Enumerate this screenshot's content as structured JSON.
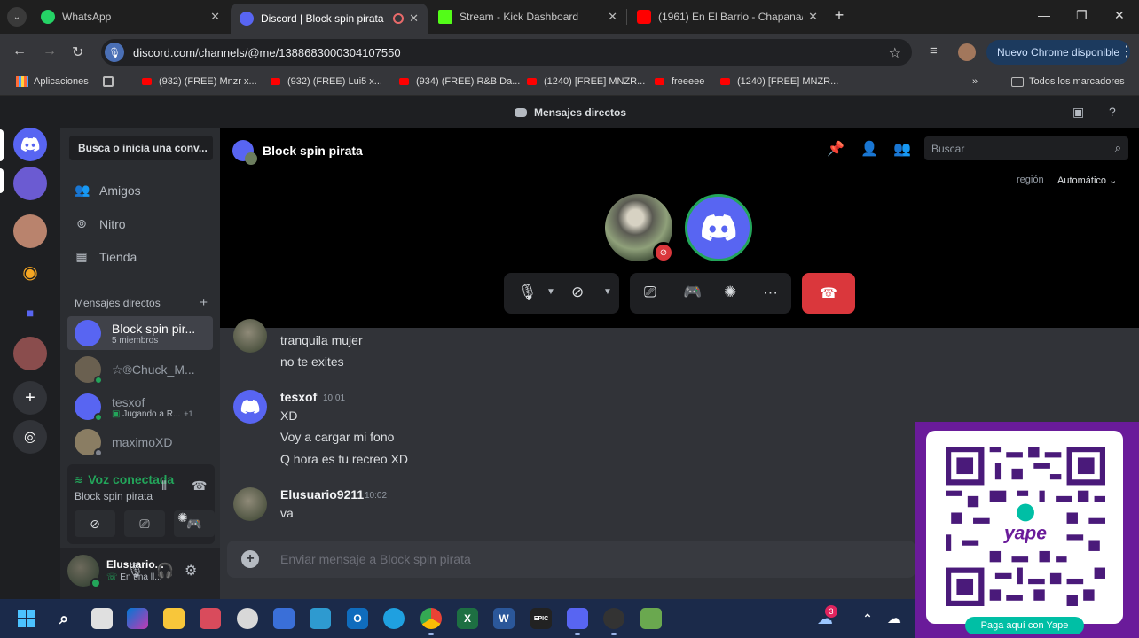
{
  "browser": {
    "tabs": [
      {
        "title": "WhatsApp",
        "color": "#25d366"
      },
      {
        "title": "Discord | Block spin pirata",
        "color": "#5865f2"
      },
      {
        "title": "Stream - Kick Dashboard",
        "color": "#53fc18"
      },
      {
        "title": "(1961) En El Barrio - Chapana/V",
        "color": "#ff0000"
      }
    ],
    "url": "discord.com/channels/@me/1388683000304107550",
    "update_button": "Nuevo Chrome disponible",
    "bookmarks": [
      "Aplicaciones",
      "(932) (FREE) Mnzr x...",
      "(932) (FREE) Lui5 x...",
      "(934) (FREE) R&B Da...",
      "(1240) [FREE] MNZR...",
      "freeeee",
      "(1240) [FREE] MNZR..."
    ],
    "bookmarks_folder": "Todos los marcadores"
  },
  "discord": {
    "window_title": "Mensajes directos",
    "dm_search": "Busca o inicia una conv...",
    "nav": [
      {
        "label": "Amigos",
        "icon": "friends-icon"
      },
      {
        "label": "Nitro",
        "icon": "nitro-icon"
      },
      {
        "label": "Tienda",
        "icon": "shop-icon"
      }
    ],
    "dm_header": "Mensajes directos",
    "dms": [
      {
        "name": "Block spin pir...",
        "sub": "5 miembros",
        "sub_extra": ""
      },
      {
        "name": "☆®Chuck_M...",
        "sub": "",
        "sub_extra": ""
      },
      {
        "name": "tesxof",
        "sub": "Jugando a R...",
        "sub_extra": "+1"
      },
      {
        "name": "maximoXD",
        "sub": "",
        "sub_extra": ""
      }
    ],
    "voice": {
      "status": "Voz conectada",
      "channel": "Block spin pirata"
    },
    "user": {
      "name": "Elusuario...",
      "sub": "En una ll..."
    },
    "channel": {
      "name": "Block spin pirata",
      "search_placeholder": "Buscar",
      "region_label": "región",
      "region_value": "Automático"
    },
    "messages": [
      {
        "author": "",
        "time": "",
        "lines": [
          "tranquila mujer",
          "no te exites"
        ]
      },
      {
        "author": "tesxof",
        "time": "10:01",
        "lines": [
          "XD",
          "Voy a cargar mi fono",
          "Q hora es tu recreo XD"
        ]
      },
      {
        "author": "Elusuario9211",
        "time": "10:02",
        "lines": [
          "va"
        ]
      }
    ],
    "composer_placeholder": "Enviar mensaje a Block spin pirata"
  },
  "overlay": {
    "yape_label": "Paga aquí con Yape",
    "yape_brand": "yape"
  },
  "taskbar": {
    "notification_count": "3"
  }
}
